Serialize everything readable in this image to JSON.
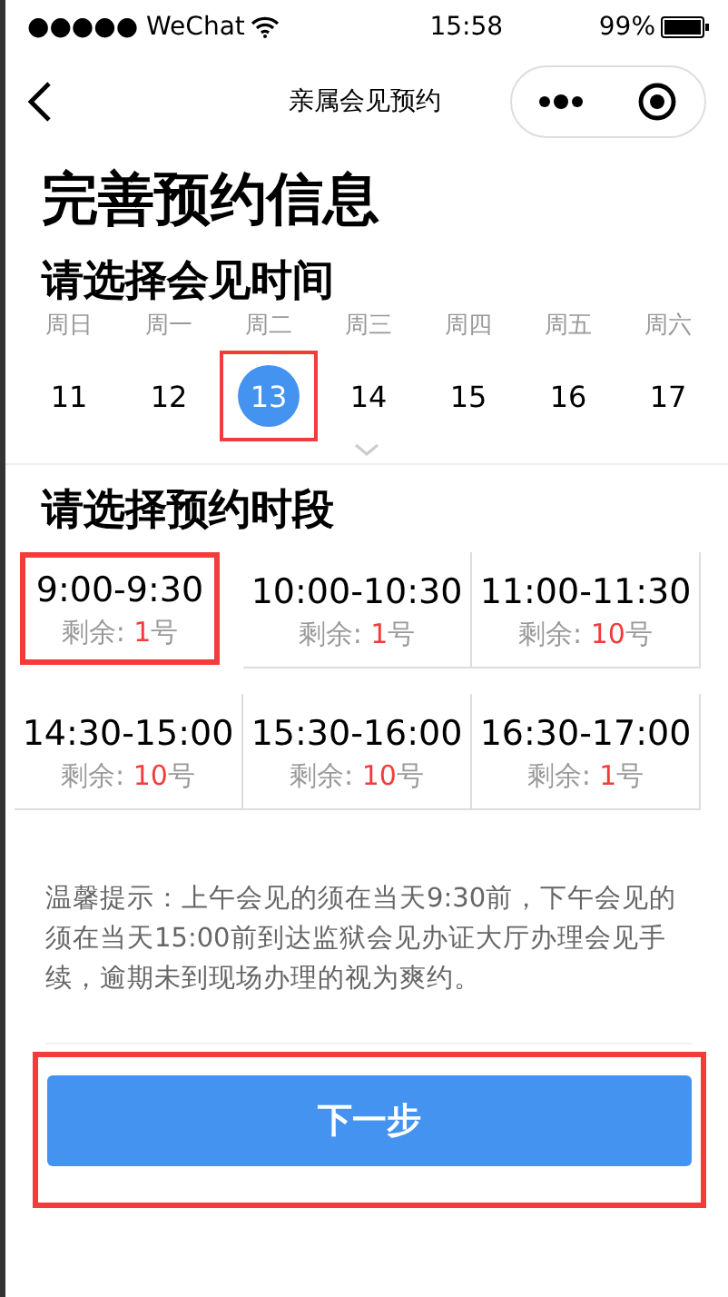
{
  "status_bar": {
    "carrier": "●●●●● WeChat",
    "time": "15:58",
    "battery": "99%"
  },
  "nav": {
    "title": "亲属会见预约"
  },
  "page_title": "完善预约信息",
  "date_section": {
    "heading": "请选择会见时间",
    "days": [
      {
        "weekday": "周日",
        "date": "11",
        "selected": false
      },
      {
        "weekday": "周一",
        "date": "12",
        "selected": false
      },
      {
        "weekday": "周二",
        "date": "13",
        "selected": true
      },
      {
        "weekday": "周三",
        "date": "14",
        "selected": false
      },
      {
        "weekday": "周四",
        "date": "15",
        "selected": false
      },
      {
        "weekday": "周五",
        "date": "16",
        "selected": false
      },
      {
        "weekday": "周六",
        "date": "17",
        "selected": false
      }
    ]
  },
  "slot_section": {
    "heading": "请选择预约时段",
    "slots": [
      {
        "time": "9:00-9:30",
        "label": "剩余:",
        "count": "1",
        "unit": "号",
        "selected": true
      },
      {
        "time": "10:00-10:30",
        "label": "剩余:",
        "count": "1",
        "unit": "号",
        "selected": false
      },
      {
        "time": "11:00-11:30",
        "label": "剩余:",
        "count": "10",
        "unit": "号",
        "selected": false
      },
      {
        "time": "14:30-15:00",
        "label": "剩余:",
        "count": "10",
        "unit": "号",
        "selected": false
      },
      {
        "time": "15:30-16:00",
        "label": "剩余:",
        "count": "10",
        "unit": "号",
        "selected": false
      },
      {
        "time": "16:30-17:00",
        "label": "剩余:",
        "count": "1",
        "unit": "号",
        "selected": false
      }
    ]
  },
  "notice": "温馨提示：上午会见的须在当天9:30前，下午会见的须在当天15:00前到达监狱会见办证大厅办理会见手续，逾期未到现场办理的视为爽约。",
  "next_button": {
    "label": "下一步",
    "highlighted": true
  }
}
